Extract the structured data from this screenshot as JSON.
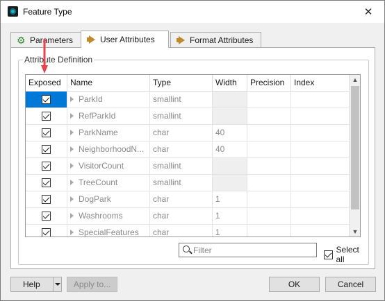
{
  "window": {
    "title": "Feature Type",
    "close_glyph": "✕"
  },
  "tabs": [
    {
      "label": "Parameters",
      "icon": "gear-icon"
    },
    {
      "label": "User Attributes",
      "icon": "arrow-icon",
      "active": true
    },
    {
      "label": "Format Attributes",
      "icon": "arrow-icon"
    }
  ],
  "group": {
    "label": "Attribute Definition"
  },
  "table": {
    "headers": [
      "Exposed",
      "Name",
      "Type",
      "Width",
      "Precision",
      "Index"
    ],
    "rows": [
      {
        "exposed": true,
        "name": "ParkId",
        "type": "smallint",
        "width": "",
        "precision": "",
        "index": ""
      },
      {
        "exposed": true,
        "name": "RefParkId",
        "type": "smallint",
        "width": "",
        "precision": "",
        "index": ""
      },
      {
        "exposed": true,
        "name": "ParkName",
        "type": "char",
        "width": "40",
        "precision": "",
        "index": ""
      },
      {
        "exposed": true,
        "name": "NeighborhoodN...",
        "type": "char",
        "width": "40",
        "precision": "",
        "index": ""
      },
      {
        "exposed": true,
        "name": "VisitorCount",
        "type": "smallint",
        "width": "",
        "precision": "",
        "index": ""
      },
      {
        "exposed": true,
        "name": "TreeCount",
        "type": "smallint",
        "width": "",
        "precision": "",
        "index": ""
      },
      {
        "exposed": true,
        "name": "DogPark",
        "type": "char",
        "width": "1",
        "precision": "",
        "index": ""
      },
      {
        "exposed": true,
        "name": "Washrooms",
        "type": "char",
        "width": "1",
        "precision": "",
        "index": ""
      },
      {
        "exposed": true,
        "name": "SpecialFeatures",
        "type": "char",
        "width": "1",
        "precision": "",
        "index": ""
      }
    ]
  },
  "filter": {
    "placeholder": "Filter",
    "value": ""
  },
  "select_all": {
    "label": "Select all",
    "checked": true
  },
  "buttons": {
    "help": "Help",
    "apply": "Apply to...",
    "ok": "OK",
    "cancel": "Cancel"
  },
  "colors": {
    "selection": "#0078d7",
    "annotation_arrow": "#e8434b"
  }
}
